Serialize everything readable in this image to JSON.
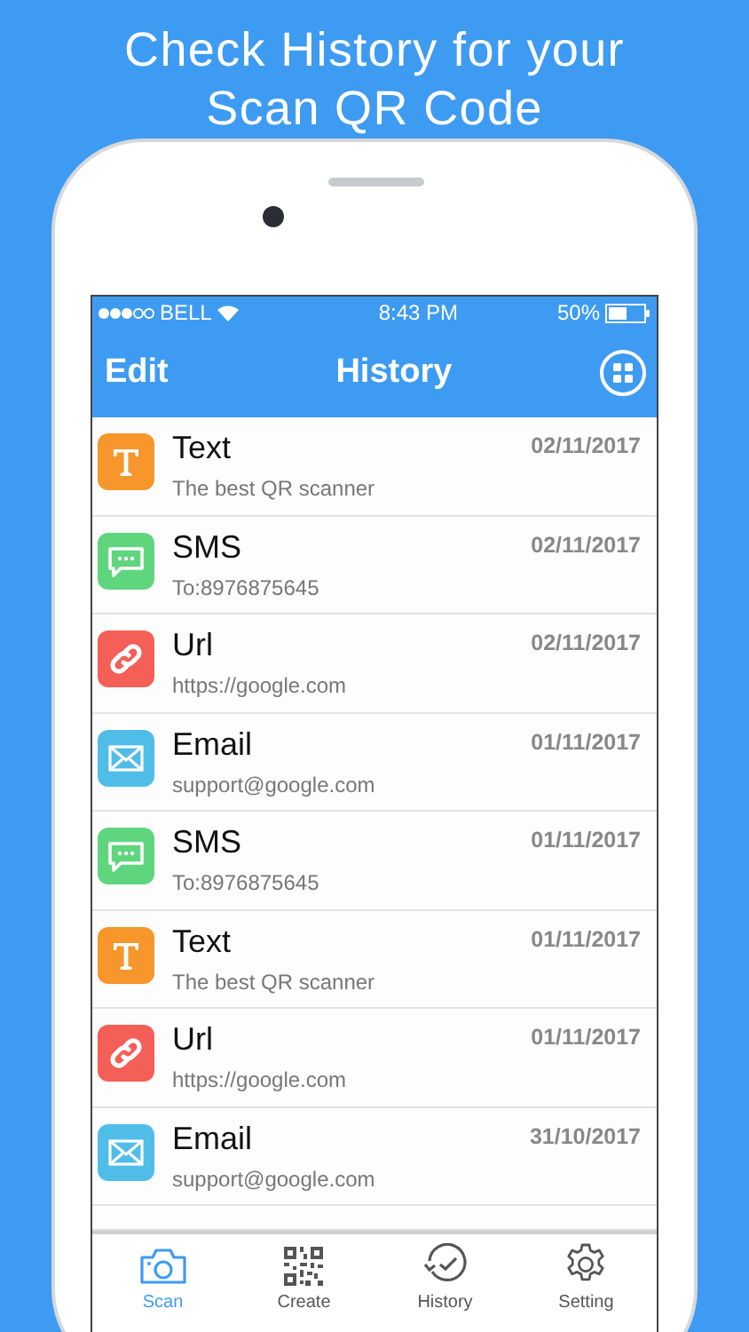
{
  "headline": [
    "Check History for your",
    "Scan QR Code"
  ],
  "status_bar": {
    "carrier": "BELL",
    "time": "8:43 PM",
    "battery": "50%"
  },
  "nav": {
    "left": "Edit",
    "title": "History"
  },
  "rows": [
    {
      "kind": "text",
      "title": "Text",
      "subtitle": "The best QR scanner",
      "date": "02/11/2017"
    },
    {
      "kind": "sms",
      "title": "SMS",
      "subtitle": "To:8976875645",
      "date": "02/11/2017"
    },
    {
      "kind": "url",
      "title": "Url",
      "subtitle": "https://google.com",
      "date": "02/11/2017"
    },
    {
      "kind": "email",
      "title": "Email",
      "subtitle": "support@google.com",
      "date": "01/11/2017"
    },
    {
      "kind": "sms",
      "title": "SMS",
      "subtitle": "To:8976875645",
      "date": "01/11/2017"
    },
    {
      "kind": "text",
      "title": "Text",
      "subtitle": "The best QR scanner",
      "date": "01/11/2017"
    },
    {
      "kind": "url",
      "title": "Url",
      "subtitle": "https://google.com",
      "date": "01/11/2017"
    },
    {
      "kind": "email",
      "title": "Email",
      "subtitle": "support@google.com",
      "date": "31/10/2017"
    }
  ],
  "tabs": [
    {
      "kind": "scan",
      "label": "Scan",
      "selected": true
    },
    {
      "kind": "create",
      "label": "Create",
      "selected": false
    },
    {
      "kind": "history",
      "label": "History",
      "selected": false
    },
    {
      "kind": "setting",
      "label": "Setting",
      "selected": false
    }
  ]
}
